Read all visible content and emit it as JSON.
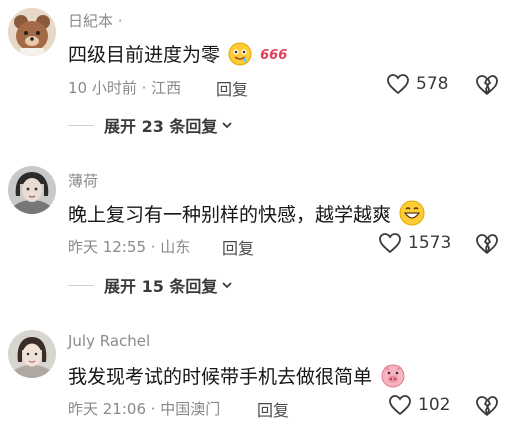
{
  "comments": [
    {
      "username": "日紀本",
      "username_suffix": "·",
      "text": "四级目前进度为零",
      "time_location": "10 小时前 · 江西",
      "reply_label": "回复",
      "likes": "578",
      "emoji": [
        "drooling-face-emoji",
        "666-sticker"
      ],
      "sticker_text": "666",
      "expand_label": "展开 23 条回复"
    },
    {
      "username": "薄荷",
      "text": "晚上复习有一种别样的快感，越学越爽",
      "time_location": "昨天 12:55 · 山东",
      "reply_label": "回复",
      "likes": "1573",
      "emoji": [
        "grinning-face-emoji"
      ],
      "expand_label": "展开 15 条回复"
    },
    {
      "username": "July Rachel",
      "text": "我发现考试的时候带手机去做很简单",
      "time_location": "昨天 21:06 · 中国澳门",
      "reply_label": "回复",
      "likes": "102",
      "emoji": [
        "pig-face-emoji"
      ]
    }
  ],
  "colors": {
    "meta": "#8a8a8a",
    "text": "#161616",
    "sticker": "#e0405a"
  }
}
